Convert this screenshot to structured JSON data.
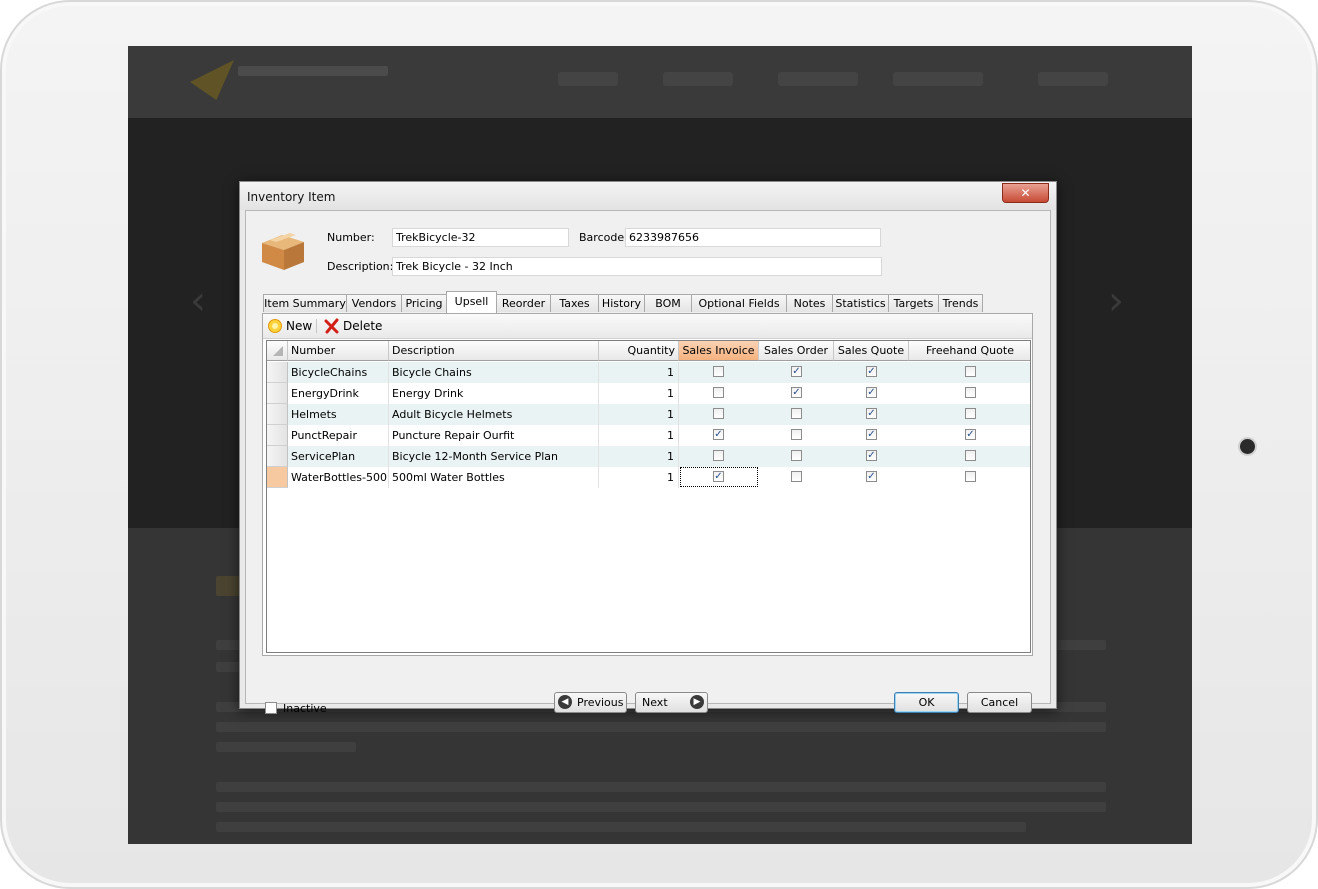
{
  "dialog": {
    "title": "Inventory Item",
    "close_label": "✕"
  },
  "header": {
    "number_label": "Number:",
    "number_value": "TrekBicycle-32",
    "barcode_label": "Barcode:",
    "barcode_value": "6233987656",
    "description_label": "Description:",
    "description_value": "Trek Bicycle - 32 Inch"
  },
  "tabs": [
    {
      "label": "Item Summary"
    },
    {
      "label": "Vendors"
    },
    {
      "label": "Pricing"
    },
    {
      "label": "Upsell"
    },
    {
      "label": "Reorder"
    },
    {
      "label": "Taxes"
    },
    {
      "label": "History"
    },
    {
      "label": "BOM"
    },
    {
      "label": "Optional Fields"
    },
    {
      "label": "Notes"
    },
    {
      "label": "Statistics"
    },
    {
      "label": "Targets"
    },
    {
      "label": "Trends"
    }
  ],
  "toolbar": {
    "new_label": "New",
    "delete_label": "Delete"
  },
  "grid": {
    "columns": [
      "Number",
      "Description",
      "Quantity",
      "Sales Invoice",
      "Sales Order",
      "Sales Quote",
      "Freehand Quote"
    ],
    "rows": [
      {
        "number": "BicycleChains",
        "description": "Bicycle Chains",
        "quantity": "1",
        "invoice": false,
        "order": true,
        "quote": true,
        "freehand": false
      },
      {
        "number": "EnergyDrink",
        "description": "Energy Drink",
        "quantity": "1",
        "invoice": false,
        "order": true,
        "quote": true,
        "freehand": false
      },
      {
        "number": "Helmets",
        "description": "Adult Bicycle Helmets",
        "quantity": "1",
        "invoice": false,
        "order": false,
        "quote": true,
        "freehand": false
      },
      {
        "number": "PunctRepair",
        "description": "Puncture Repair Ourfit",
        "quantity": "1",
        "invoice": true,
        "order": false,
        "quote": true,
        "freehand": true
      },
      {
        "number": "ServicePlan",
        "description": "Bicycle 12-Month Service Plan",
        "quantity": "1",
        "invoice": false,
        "order": false,
        "quote": true,
        "freehand": false
      },
      {
        "number": "WaterBottles-500",
        "description": "500ml Water Bottles",
        "quantity": "1",
        "invoice": true,
        "order": false,
        "quote": true,
        "freehand": false
      }
    ]
  },
  "footer": {
    "inactive_label": "Inactive",
    "previous_label": "Previous",
    "next_label": "Next",
    "ok_label": "OK",
    "cancel_label": "Cancel"
  }
}
